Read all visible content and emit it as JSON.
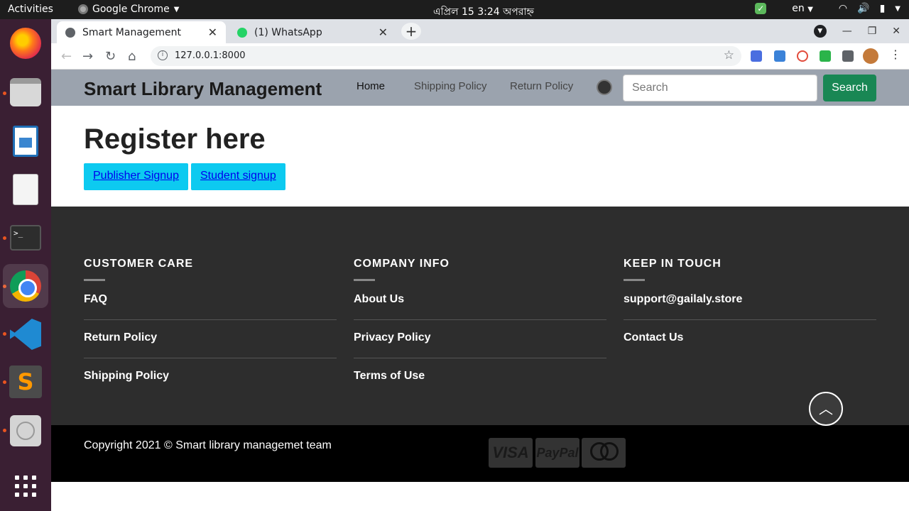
{
  "system_bar": {
    "activities": "Activities",
    "app_name": "Google Chrome",
    "clock": "এপ্রিল 15   3:24 অপরাহ্ন",
    "language": "en"
  },
  "browser": {
    "tabs": [
      {
        "title": "Smart Management",
        "active": true
      },
      {
        "title": "(1) WhatsApp",
        "active": false
      }
    ],
    "url": "127.0.0.1:8000"
  },
  "site": {
    "brand": "Smart Library Management",
    "nav": {
      "home": "Home",
      "shipping": "Shipping Policy",
      "return": "Return Policy"
    },
    "search": {
      "placeholder": "Search",
      "button": "Search"
    },
    "register_title": "Register here",
    "buttons": {
      "publisher": "Publisher Signup",
      "student": "Student signup"
    },
    "footer": {
      "customer_care": {
        "heading": "CUSTOMER CARE",
        "links": [
          "FAQ",
          "Return Policy",
          "Shipping Policy"
        ]
      },
      "company_info": {
        "heading": "COMPANY INFO",
        "links": [
          "About Us",
          "Privacy Policy",
          "Terms of Use"
        ]
      },
      "keep_in_touch": {
        "heading": "KEEP IN TOUCH",
        "links": [
          "support@gailaly.store",
          "Contact Us"
        ]
      }
    },
    "copyright": "Copyright 2021 © Smart library managemet team",
    "payment": {
      "visa": "VISA",
      "paypal": "PayPal"
    }
  },
  "colors": {
    "navbar_bg": "#9ba3ae",
    "search_button": "#198754",
    "register_buttons": "#0dcaf0",
    "footer_bg": "#2d2d2d",
    "bottom_bg": "#000000",
    "dock_bg": "#3a1f33"
  }
}
